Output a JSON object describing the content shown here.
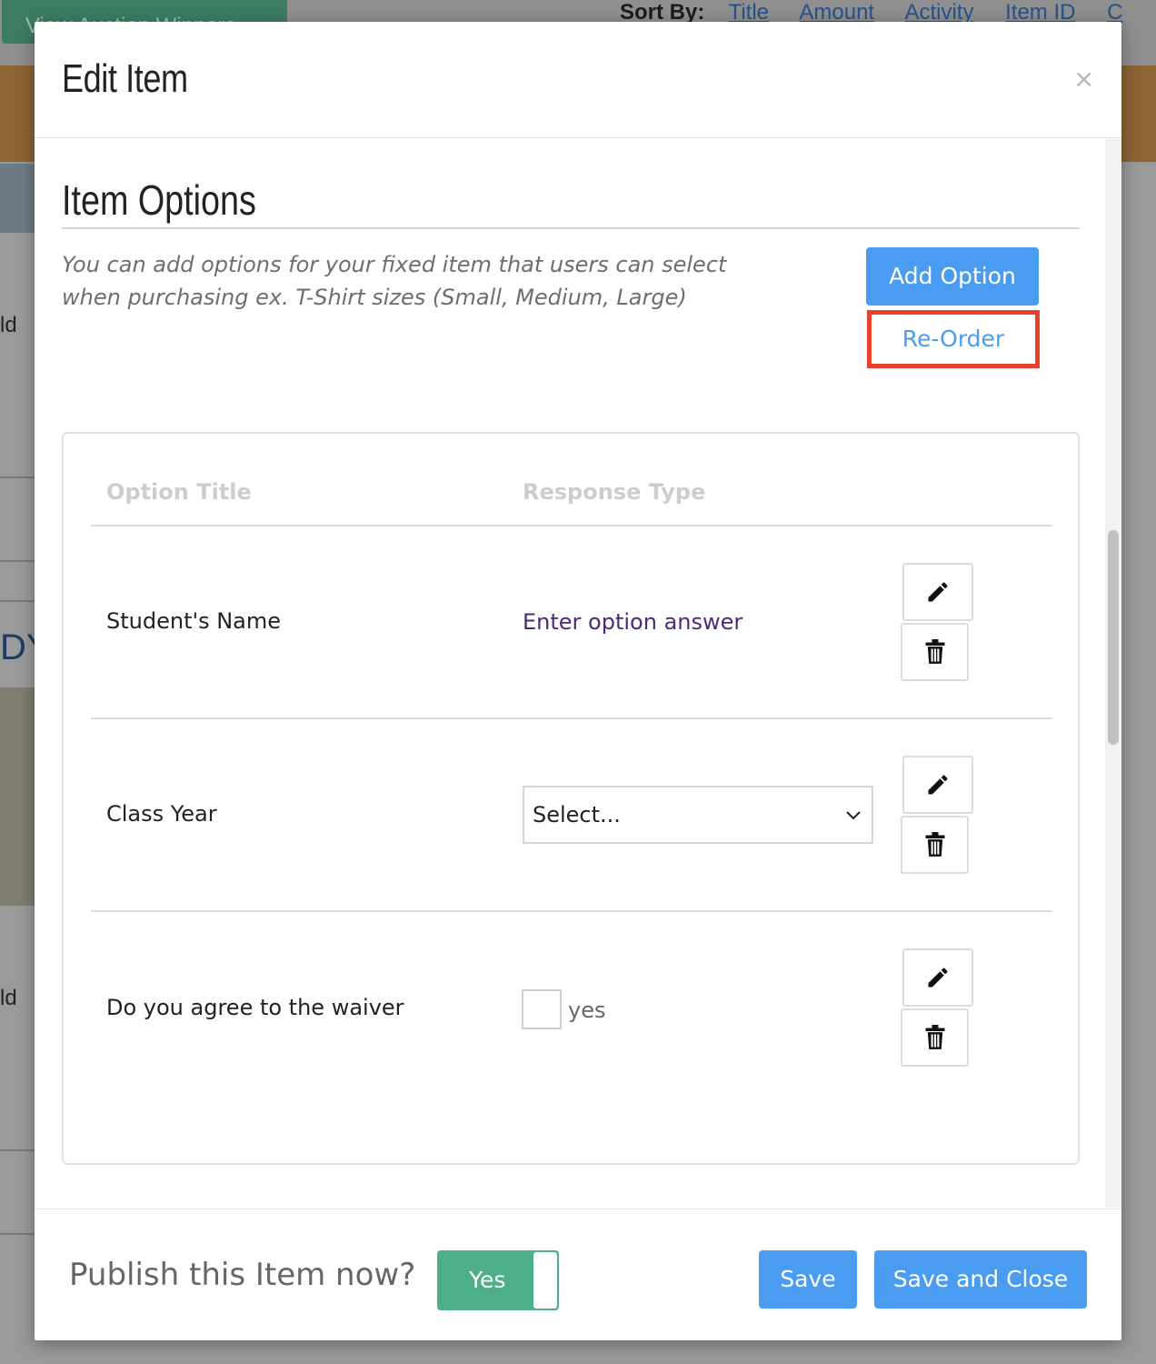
{
  "background": {
    "view_winners_button": "View Auction Winners",
    "sort_by_label": "Sort By:",
    "sort_links": [
      "Title",
      "Amount",
      "Activity",
      "Item ID",
      "C"
    ],
    "fragment_ld_1": "ld",
    "fragment_dy": "DY",
    "fragment_ld_2": "ld"
  },
  "modal": {
    "title": "Edit Item",
    "close_glyph": "×",
    "section_title": "Item Options",
    "description": "You can add options for your fixed item that users can select when purchasing ex. T-Shirt sizes (Small, Medium, Large)",
    "add_option_label": "Add Option",
    "reorder_label": "Re-Order",
    "columns": {
      "title": "Option Title",
      "type": "Response Type"
    },
    "options": [
      {
        "title": "Student's Name",
        "response": "Enter option answer",
        "response_type": "text-link"
      },
      {
        "title": "Class Year",
        "response": "Select...",
        "response_type": "select"
      },
      {
        "title": "Do you agree to the waiver",
        "response": "yes",
        "response_type": "checkbox"
      }
    ],
    "icons": {
      "edit": "pencil-icon",
      "delete": "trash-icon",
      "close": "close-icon",
      "dropdown": "chevron-down-icon"
    },
    "footer": {
      "publish_label": "Publish this Item now?",
      "publish_toggle": "Yes",
      "save_label": "Save",
      "save_close_label": "Save and Close"
    }
  },
  "colors": {
    "primary": "#4a9cf0",
    "highlight_border": "#e8412c",
    "toggle_on": "#4daf88",
    "link_purple": "#4b2a7a"
  }
}
